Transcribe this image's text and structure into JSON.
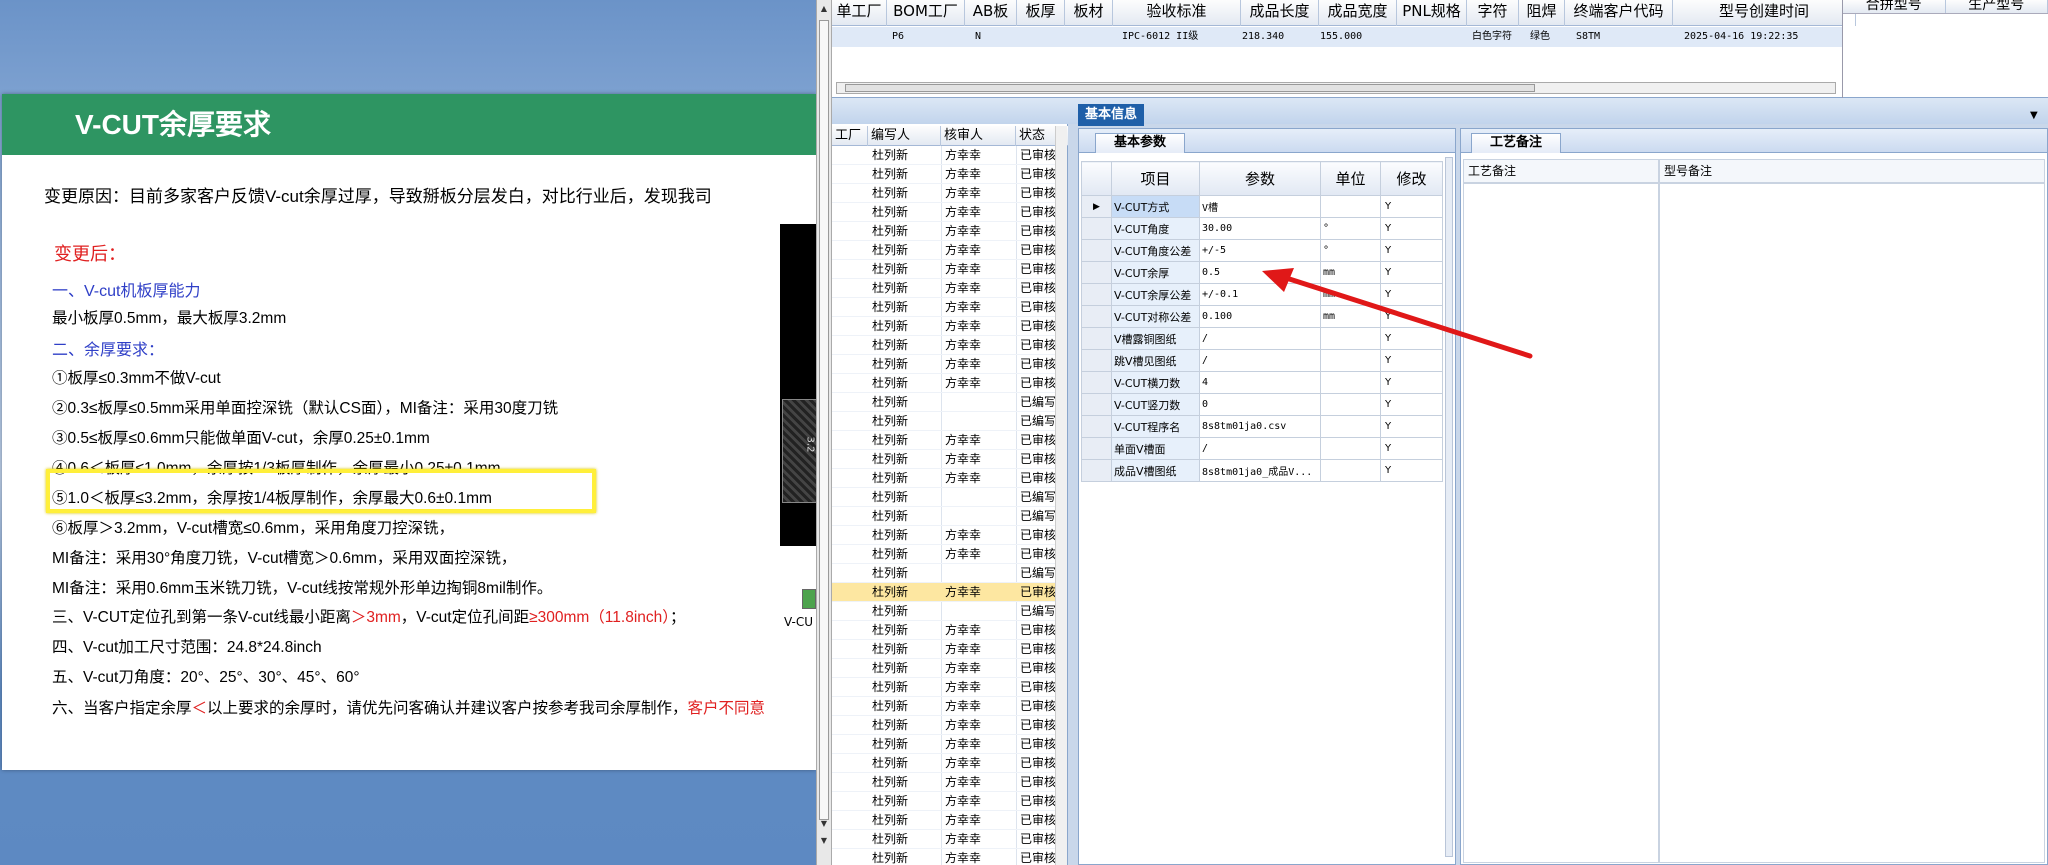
{
  "slide": {
    "title": "V-CUT余厚要求",
    "reason": "变更原因：目前多家客户反馈V-cut余厚过厚，导致掰板分层发白，对比行业后，发现我司",
    "after_label": "变更后：",
    "lines": [
      {
        "text": "一、V-cut机板厚能力",
        "style": "blue"
      },
      {
        "text": "最小板厚0.5mm，最大板厚3.2mm",
        "style": "normal"
      },
      {
        "text": "二、余厚要求：",
        "style": "blue"
      },
      {
        "text": "①板厚≤0.3mm不做V-cut",
        "style": "normal"
      },
      {
        "text": "  ②0.3≤板厚≤0.5mm采用单面控深铣（默认CS面），MI备注：采用30度刀铣",
        "style": "normal"
      },
      {
        "text": "  ③0.5≤板厚≤0.6mm只能做单面V-cut，余厚0.25±0.1mm",
        "style": "normal"
      },
      {
        "text": "  ④0.6＜板厚≤1.0mm，余厚按1/3板厚制作，余厚最小0.25±0.1mm",
        "style": "normal"
      },
      {
        "text": "  ⑤1.0＜板厚≤3.2mm，余厚按1/4板厚制作，余厚最大0.6±0.1mm",
        "style": "normal"
      },
      {
        "text": "  ⑥板厚＞3.2mm，V-cut槽宽≤0.6mm，采用角度刀控深铣，",
        "style": "normal"
      },
      {
        "text": "  MI备注：采用30°角度刀铣，V-cut槽宽＞0.6mm，采用双面控深铣，",
        "style": "normal"
      },
      {
        "text": "  MI备注：采用0.6mm玉米铣刀铣，V-cut线按常规外形单边掏铜8mil制作。",
        "style": "normal"
      }
    ],
    "line3_a": "三、V-CUT定位孔到第一条V-cut线最小距离",
    "line3_b": "＞3mm",
    "line3_c": "，V-cut定位孔间距",
    "line3_d": "≥300mm（11.8inch）",
    "line3_e": "；",
    "line4": "四、V-cut加工尺寸范围：24.8*24.8inch",
    "line5": "五、V-cut刀角度：20°、25°、30°、45°、60°",
    "line6_a": "六、当客户指定余厚",
    "line6_b": "＜",
    "line6_c": "以上要求的余厚时，请优先问客确认并建议客户按参考我司余厚制作，",
    "line6_d": "客户不同意",
    "image_label": "3.2",
    "vcut_label": "V-CU"
  },
  "top_grid": {
    "headers": [
      "单工厂",
      "BOM工厂",
      "AB板",
      "板厚",
      "板材",
      "验收标准",
      "成品长度",
      "成品宽度",
      "PNL规格",
      "字符",
      "阻焊",
      "终端客户代码",
      "型号创建时间"
    ],
    "row": {
      "bom": "P6",
      "ab": "N",
      "std": "IPC-6012 II级",
      "len": "218.340",
      "wid": "155.000",
      "char": "白色字符",
      "mask": "绿色",
      "cust": "S8TM",
      "created": "2025-04-16 19:22:35"
    },
    "right_headers": [
      "合拼型号",
      "生产型号"
    ]
  },
  "list": {
    "headers": [
      "工厂",
      "编写人",
      "核审人",
      "状态"
    ],
    "rows": [
      [
        "杜列新",
        "方幸幸",
        "已审核"
      ],
      [
        "杜列新",
        "方幸幸",
        "已审核"
      ],
      [
        "杜列新",
        "方幸幸",
        "已审核"
      ],
      [
        "杜列新",
        "方幸幸",
        "已审核"
      ],
      [
        "杜列新",
        "方幸幸",
        "已审核"
      ],
      [
        "杜列新",
        "方幸幸",
        "已审核"
      ],
      [
        "杜列新",
        "方幸幸",
        "已审核"
      ],
      [
        "杜列新",
        "方幸幸",
        "已审核"
      ],
      [
        "杜列新",
        "方幸幸",
        "已审核"
      ],
      [
        "杜列新",
        "方幸幸",
        "已审核"
      ],
      [
        "杜列新",
        "方幸幸",
        "已审核"
      ],
      [
        "杜列新",
        "方幸幸",
        "已审核"
      ],
      [
        "杜列新",
        "方幸幸",
        "已审核"
      ],
      [
        "杜列新",
        "",
        "已编写"
      ],
      [
        "杜列新",
        "",
        "已编写"
      ],
      [
        "杜列新",
        "方幸幸",
        "已审核"
      ],
      [
        "杜列新",
        "方幸幸",
        "已审核"
      ],
      [
        "杜列新",
        "方幸幸",
        "已审核"
      ],
      [
        "杜列新",
        "",
        "已编写"
      ],
      [
        "杜列新",
        "",
        "已编写"
      ],
      [
        "杜列新",
        "方幸幸",
        "已审核"
      ],
      [
        "杜列新",
        "方幸幸",
        "已审核"
      ],
      [
        "杜列新",
        "",
        "已编写"
      ],
      [
        "杜列新",
        "方幸幸",
        "已审核"
      ],
      [
        "杜列新",
        "",
        "已编写"
      ],
      [
        "杜列新",
        "方幸幸",
        "已审核"
      ],
      [
        "杜列新",
        "方幸幸",
        "已审核"
      ],
      [
        "杜列新",
        "方幸幸",
        "已审核"
      ],
      [
        "杜列新",
        "方幸幸",
        "已审核"
      ],
      [
        "杜列新",
        "方幸幸",
        "已审核"
      ],
      [
        "杜列新",
        "方幸幸",
        "已审核"
      ],
      [
        "杜列新",
        "方幸幸",
        "已审核"
      ],
      [
        "杜列新",
        "方幸幸",
        "已审核"
      ],
      [
        "杜列新",
        "方幸幸",
        "已审核"
      ],
      [
        "杜列新",
        "方幸幸",
        "已审核"
      ],
      [
        "杜列新",
        "方幸幸",
        "已审核"
      ],
      [
        "杜列新",
        "方幸幸",
        "已审核"
      ],
      [
        "杜列新",
        "方幸幸",
        "已审核"
      ]
    ],
    "selected_index": 23
  },
  "strip": {
    "tab": "基本信息"
  },
  "params": {
    "tab": "基本参数",
    "headers": [
      "项目",
      "参数",
      "单位",
      "修改"
    ],
    "rows": [
      [
        "V-CUT方式",
        "V槽",
        "",
        "Y"
      ],
      [
        "V-CUT角度",
        "30.00",
        "°",
        "Y"
      ],
      [
        "V-CUT角度公差",
        "+/-5",
        "°",
        "Y"
      ],
      [
        "V-CUT余厚",
        "0.5",
        "mm",
        "Y"
      ],
      [
        "V-CUT余厚公差",
        "+/-0.1",
        "mm",
        "Y"
      ],
      [
        "V-CUT对称公差",
        "0.100",
        "mm",
        "Y"
      ],
      [
        "V槽露铜图纸",
        "/",
        "",
        "Y"
      ],
      [
        "跳V槽见图纸",
        "/",
        "",
        "Y"
      ],
      [
        "V-CUT横刀数",
        "4",
        "",
        "Y"
      ],
      [
        "V-CUT竖刀数",
        "0",
        "",
        "Y"
      ],
      [
        "V-CUT程序名",
        "8s8tm01ja0.csv",
        "",
        "Y"
      ],
      [
        "单面V槽面",
        "/",
        "",
        "Y"
      ],
      [
        "成品V槽图纸",
        "8s8tm01ja0_成品V...",
        "",
        "Y"
      ]
    ]
  },
  "notes": {
    "tab": "工艺备注",
    "col1": "工艺备注",
    "col2": "型号备注"
  },
  "colors": {
    "arrow": "#e01818",
    "highlight": "#ffef3a",
    "slide_title_bg": "#2e9562"
  }
}
